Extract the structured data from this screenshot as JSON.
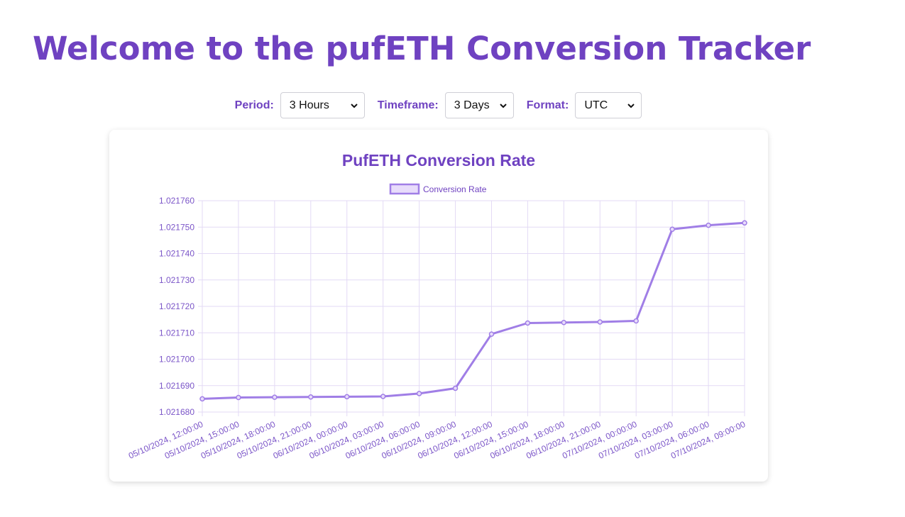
{
  "page": {
    "title": "Welcome to the pufETH Conversion Tracker"
  },
  "controls": {
    "period": {
      "label": "Period:",
      "value": "3 Hours"
    },
    "timeframe": {
      "label": "Timeframe:",
      "value": "3 Days"
    },
    "format": {
      "label": "Format:",
      "value": "UTC"
    }
  },
  "colors": {
    "accent": "#6f42c1",
    "line": "#a07ee6",
    "legend_fill": "#e8dcfb",
    "grid": "#e3daf5"
  },
  "chart_data": {
    "type": "line",
    "title": "PufETH Conversion Rate",
    "grid": true,
    "legend_position": "top-center",
    "ylim": [
      1.02168,
      1.02176
    ],
    "yticks": [
      "1.021760",
      "1.021750",
      "1.021740",
      "1.021730",
      "1.021720",
      "1.021710",
      "1.021700",
      "1.021690",
      "1.021680"
    ],
    "x": [
      "05/10/2024, 12:00:00",
      "05/10/2024, 15:00:00",
      "05/10/2024, 18:00:00",
      "05/10/2024, 21:00:00",
      "06/10/2024, 00:00:00",
      "06/10/2024, 03:00:00",
      "06/10/2024, 06:00:00",
      "06/10/2024, 09:00:00",
      "06/10/2024, 12:00:00",
      "06/10/2024, 15:00:00",
      "06/10/2024, 18:00:00",
      "06/10/2024, 21:00:00",
      "07/10/2024, 00:00:00",
      "07/10/2024, 03:00:00",
      "07/10/2024, 06:00:00",
      "07/10/2024, 09:00:00"
    ],
    "series": [
      {
        "name": "Conversion Rate",
        "values": [
          1.021685,
          1.0216855,
          1.0216856,
          1.0216857,
          1.0216858,
          1.0216859,
          1.021687,
          1.021689,
          1.0217095,
          1.0217137,
          1.0217139,
          1.0217141,
          1.0217145,
          1.0217492,
          1.0217507,
          1.0217516
        ]
      }
    ]
  }
}
